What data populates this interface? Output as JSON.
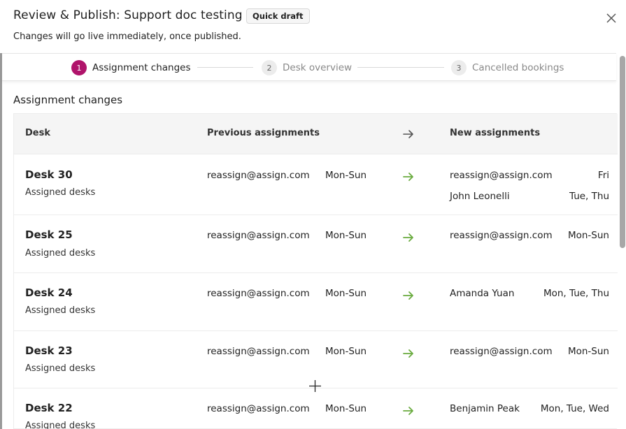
{
  "dialog": {
    "title": "Review & Publish: Support doc testing",
    "badge": "Quick draft",
    "subtitle": "Changes will go live immediately, once published."
  },
  "stepper": {
    "steps": [
      {
        "number": "1",
        "label": "Assignment changes",
        "active": true
      },
      {
        "number": "2",
        "label": "Desk overview",
        "active": false
      },
      {
        "number": "3",
        "label": "Cancelled bookings",
        "active": false
      }
    ]
  },
  "section": {
    "title": "Assignment changes"
  },
  "table": {
    "headers": {
      "desk": "Desk",
      "previous": "Previous assignments",
      "new": "New assignments"
    },
    "rows": [
      {
        "desk": "Desk 30",
        "type": "Assigned desks",
        "prev_assignee": "reassign@assign.com",
        "prev_days": "Mon-Sun",
        "new": [
          {
            "assignee": "reassign@assign.com",
            "days": "Fri"
          },
          {
            "assignee": "John Leonelli",
            "days": "Tue, Thu"
          }
        ]
      },
      {
        "desk": "Desk 25",
        "type": "Assigned desks",
        "prev_assignee": "reassign@assign.com",
        "prev_days": "Mon-Sun",
        "new": [
          {
            "assignee": "reassign@assign.com",
            "days": "Mon-Sun"
          }
        ]
      },
      {
        "desk": "Desk 24",
        "type": "Assigned desks",
        "prev_assignee": "reassign@assign.com",
        "prev_days": "Mon-Sun",
        "new": [
          {
            "assignee": "Amanda Yuan",
            "days": "Mon, Tue, Thu"
          }
        ]
      },
      {
        "desk": "Desk 23",
        "type": "Assigned desks",
        "prev_assignee": "reassign@assign.com",
        "prev_days": "Mon-Sun",
        "new": [
          {
            "assignee": "reassign@assign.com",
            "days": "Mon-Sun"
          }
        ]
      },
      {
        "desk": "Desk 22",
        "type": "Assigned desks",
        "prev_assignee": "reassign@assign.com",
        "prev_days": "Mon-Sun",
        "new": [
          {
            "assignee": "Benjamin Peak",
            "days": "Mon, Tue, Wed"
          }
        ]
      }
    ]
  },
  "icons": {
    "close": "close-icon",
    "arrow": "arrow-right-icon",
    "cursor": "crosshair-cursor-icon"
  },
  "colors": {
    "accent": "#b0146b",
    "arrow_green": "#6aab3f",
    "header_arrow": "#555555"
  }
}
